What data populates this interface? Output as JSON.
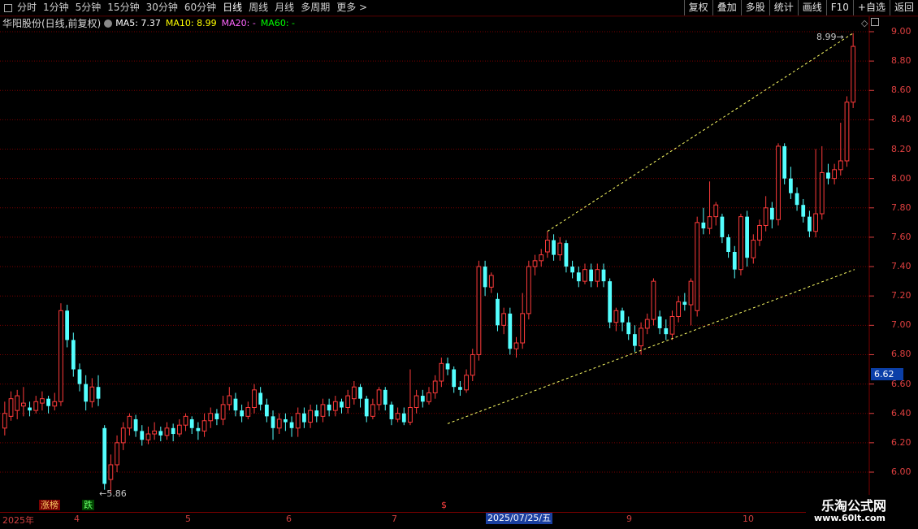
{
  "toolbar": {
    "left_items": [
      "分时",
      "1分钟",
      "5分钟",
      "15分钟",
      "30分钟",
      "60分钟",
      "日线",
      "周线",
      "月线",
      "多周期",
      "更多 >"
    ],
    "active": "日线",
    "right_items": [
      "复权",
      "叠加",
      "多股",
      "统计",
      "画线",
      "F10",
      "+自选",
      "返回"
    ]
  },
  "info": {
    "stock_name": "华阳股份(日线,前复权)",
    "ma5": "MA5: 7.37",
    "ma10": "MA10: 8.99",
    "ma20": "MA20: -",
    "ma60": "MA60: -"
  },
  "colors": {
    "up": "#ff3b3b",
    "down": "#54ffff",
    "axis": "#e04040",
    "grid": "#7a0000",
    "trend": "#ffff66",
    "ma5": "#ffffff",
    "ma10": "#ffff00",
    "ma20": "#ff66ff",
    "ma60": "#00ff00"
  },
  "y_axis": [
    "9.00",
    "8.80",
    "8.60",
    "8.40",
    "8.20",
    "8.00",
    "7.80",
    "7.60",
    "7.40",
    "7.20",
    "7.00",
    "6.80",
    "6.60",
    "6.40",
    "6.20",
    "6.00"
  ],
  "current_price": "6.62",
  "high_label": "8.99",
  "low_label": "5.86",
  "dates": {
    "d0": "2025年",
    "d4": "4",
    "d5": "5",
    "d6": "6",
    "d7": "7",
    "selected": "2025/07/25/五",
    "d9": "9",
    "d10": "10"
  },
  "badges": {
    "b1": "涨榜",
    "b2": "跌",
    "b3": "$"
  },
  "watermark": {
    "title": "乐淘公式网",
    "url": "www.60lt.com"
  },
  "chart_data": {
    "type": "candlestick",
    "ylim": [
      5.9,
      9.02
    ],
    "candles": [
      [
        6.3,
        6.4,
        6.25,
        6.48
      ],
      [
        6.38,
        6.5,
        6.35,
        6.55
      ],
      [
        6.42,
        6.52,
        6.36,
        6.56
      ],
      [
        6.45,
        6.47,
        6.38,
        6.58
      ],
      [
        6.44,
        6.42,
        6.38,
        6.48
      ],
      [
        6.42,
        6.48,
        6.4,
        6.52
      ],
      [
        6.47,
        6.5,
        6.42,
        6.55
      ],
      [
        6.5,
        6.45,
        6.4,
        6.52
      ],
      [
        6.45,
        6.48,
        6.42,
        6.54
      ],
      [
        6.48,
        7.1,
        6.45,
        7.15
      ],
      [
        7.1,
        6.9,
        6.85,
        7.14
      ],
      [
        6.9,
        6.7,
        6.65,
        6.95
      ],
      [
        6.7,
        6.6,
        6.55,
        6.74
      ],
      [
        6.6,
        6.48,
        6.42,
        6.66
      ],
      [
        6.48,
        6.58,
        6.44,
        6.64
      ],
      [
        6.58,
        6.5,
        6.45,
        6.66
      ],
      [
        6.3,
        5.92,
        5.88,
        6.32
      ],
      [
        5.95,
        6.05,
        5.86,
        6.12
      ],
      [
        6.05,
        6.2,
        6.0,
        6.25
      ],
      [
        6.2,
        6.3,
        6.15,
        6.34
      ],
      [
        6.3,
        6.38,
        6.25,
        6.4
      ],
      [
        6.36,
        6.28,
        6.24,
        6.39
      ],
      [
        6.28,
        6.22,
        6.18,
        6.32
      ],
      [
        6.22,
        6.26,
        6.19,
        6.31
      ],
      [
        6.26,
        6.28,
        6.22,
        6.34
      ],
      [
        6.28,
        6.25,
        6.21,
        6.31
      ],
      [
        6.25,
        6.3,
        6.22,
        6.34
      ],
      [
        6.3,
        6.26,
        6.21,
        6.33
      ],
      [
        6.26,
        6.32,
        6.24,
        6.36
      ],
      [
        6.32,
        6.38,
        6.28,
        6.4
      ],
      [
        6.36,
        6.3,
        6.26,
        6.38
      ],
      [
        6.3,
        6.28,
        6.22,
        6.34
      ],
      [
        6.28,
        6.35,
        6.24,
        6.4
      ],
      [
        6.35,
        6.4,
        6.3,
        6.44
      ],
      [
        6.4,
        6.36,
        6.32,
        6.43
      ],
      [
        6.36,
        6.46,
        6.32,
        6.52
      ],
      [
        6.46,
        6.52,
        6.42,
        6.58
      ],
      [
        6.5,
        6.42,
        6.38,
        6.54
      ],
      [
        6.42,
        6.38,
        6.34,
        6.46
      ],
      [
        6.38,
        6.44,
        6.36,
        6.48
      ],
      [
        6.44,
        6.56,
        6.4,
        6.6
      ],
      [
        6.54,
        6.46,
        6.42,
        6.58
      ],
      [
        6.46,
        6.38,
        6.34,
        6.5
      ],
      [
        6.38,
        6.3,
        6.22,
        6.42
      ],
      [
        6.3,
        6.36,
        6.26,
        6.4
      ],
      [
        6.36,
        6.34,
        6.28,
        6.4
      ],
      [
        6.34,
        6.3,
        6.24,
        6.38
      ],
      [
        6.3,
        6.4,
        6.24,
        6.44
      ],
      [
        6.4,
        6.34,
        6.3,
        6.44
      ],
      [
        6.34,
        6.42,
        6.3,
        6.46
      ],
      [
        6.42,
        6.38,
        6.34,
        6.46
      ],
      [
        6.38,
        6.46,
        6.34,
        6.5
      ],
      [
        6.46,
        6.42,
        6.38,
        6.5
      ],
      [
        6.42,
        6.48,
        6.38,
        6.52
      ],
      [
        6.48,
        6.44,
        6.4,
        6.5
      ],
      [
        6.44,
        6.52,
        6.4,
        6.56
      ],
      [
        6.5,
        6.58,
        6.46,
        6.62
      ],
      [
        6.58,
        6.5,
        6.44,
        6.6
      ],
      [
        6.5,
        6.38,
        6.34,
        6.52
      ],
      [
        6.38,
        6.46,
        6.36,
        6.5
      ],
      [
        6.46,
        6.56,
        6.42,
        6.58
      ],
      [
        6.56,
        6.46,
        6.42,
        6.58
      ],
      [
        6.46,
        6.36,
        6.32,
        6.48
      ],
      [
        6.36,
        6.4,
        6.34,
        6.44
      ],
      [
        6.4,
        6.34,
        6.32,
        6.44
      ],
      [
        6.34,
        6.44,
        6.32,
        6.7
      ],
      [
        6.44,
        6.52,
        6.4,
        6.56
      ],
      [
        6.52,
        6.48,
        6.44,
        6.56
      ],
      [
        6.48,
        6.54,
        6.46,
        6.58
      ],
      [
        6.54,
        6.62,
        6.5,
        6.66
      ],
      [
        6.62,
        6.74,
        6.58,
        6.78
      ],
      [
        6.74,
        6.7,
        6.66,
        6.78
      ],
      [
        6.7,
        6.58,
        6.54,
        6.72
      ],
      [
        6.58,
        6.56,
        6.52,
        6.62
      ],
      [
        6.56,
        6.66,
        6.54,
        6.7
      ],
      [
        6.66,
        6.8,
        6.62,
        6.84
      ],
      [
        6.8,
        7.4,
        6.76,
        7.44
      ],
      [
        7.4,
        7.26,
        7.2,
        7.44
      ],
      [
        7.26,
        7.34,
        7.22,
        7.36
      ],
      [
        7.18,
        7.0,
        6.96,
        7.22
      ],
      [
        7.0,
        7.08,
        6.94,
        7.12
      ],
      [
        7.08,
        6.84,
        6.8,
        7.12
      ],
      [
        6.84,
        6.88,
        6.78,
        6.92
      ],
      [
        6.88,
        7.08,
        6.84,
        7.22
      ],
      [
        7.08,
        7.4,
        7.04,
        7.44
      ],
      [
        7.4,
        7.44,
        7.34,
        7.48
      ],
      [
        7.44,
        7.48,
        7.4,
        7.52
      ],
      [
        7.5,
        7.58,
        7.46,
        7.64
      ],
      [
        7.58,
        7.48,
        7.44,
        7.62
      ],
      [
        7.48,
        7.56,
        7.44,
        7.6
      ],
      [
        7.56,
        7.4,
        7.36,
        7.58
      ],
      [
        7.4,
        7.36,
        7.32,
        7.44
      ],
      [
        7.36,
        7.3,
        7.26,
        7.4
      ],
      [
        7.3,
        7.38,
        7.28,
        7.42
      ],
      [
        7.38,
        7.3,
        7.26,
        7.42
      ],
      [
        7.3,
        7.38,
        7.26,
        7.42
      ],
      [
        7.38,
        7.3,
        7.26,
        7.42
      ],
      [
        7.3,
        7.02,
        6.98,
        7.32
      ],
      [
        7.02,
        7.1,
        6.96,
        7.12
      ],
      [
        7.1,
        7.02,
        6.96,
        7.12
      ],
      [
        7.02,
        6.94,
        6.9,
        7.06
      ],
      [
        6.94,
        6.86,
        6.82,
        7.0
      ],
      [
        6.86,
        6.98,
        6.8,
        7.02
      ],
      [
        6.98,
        7.04,
        6.94,
        7.08
      ],
      [
        7.04,
        7.3,
        7.0,
        7.32
      ],
      [
        7.06,
        6.98,
        6.94,
        7.1
      ],
      [
        6.98,
        6.94,
        6.9,
        7.04
      ],
      [
        6.94,
        7.06,
        6.9,
        7.1
      ],
      [
        7.06,
        7.16,
        7.02,
        7.2
      ],
      [
        7.16,
        7.14,
        7.1,
        7.22
      ],
      [
        7.14,
        7.3,
        7.0,
        7.32
      ],
      [
        7.1,
        7.7,
        7.06,
        7.74
      ],
      [
        7.7,
        7.66,
        7.62,
        7.8
      ],
      [
        7.66,
        7.74,
        7.62,
        7.98
      ],
      [
        7.74,
        7.82,
        7.68,
        7.84
      ],
      [
        7.74,
        7.6,
        7.56,
        7.76
      ],
      [
        7.6,
        7.5,
        7.46,
        7.62
      ],
      [
        7.5,
        7.38,
        7.32,
        7.54
      ],
      [
        7.38,
        7.74,
        7.34,
        7.76
      ],
      [
        7.74,
        7.46,
        7.4,
        7.78
      ],
      [
        7.46,
        7.58,
        7.42,
        7.62
      ],
      [
        7.58,
        7.68,
        7.54,
        7.72
      ],
      [
        7.68,
        7.8,
        7.64,
        7.88
      ],
      [
        7.8,
        7.72,
        7.66,
        7.84
      ],
      [
        7.72,
        8.22,
        7.68,
        8.24
      ],
      [
        8.22,
        8.0,
        7.96,
        8.24
      ],
      [
        8.0,
        7.9,
        7.86,
        8.08
      ],
      [
        7.9,
        7.82,
        7.78,
        7.94
      ],
      [
        7.82,
        7.74,
        7.7,
        7.86
      ],
      [
        7.74,
        7.64,
        7.6,
        7.78
      ],
      [
        7.64,
        7.76,
        7.6,
        8.2
      ],
      [
        7.76,
        8.04,
        7.72,
        8.22
      ],
      [
        8.04,
        8.0,
        7.96,
        8.1
      ],
      [
        8.0,
        8.06,
        7.96,
        8.1
      ],
      [
        8.06,
        8.12,
        8.02,
        8.38
      ],
      [
        8.12,
        8.52,
        8.08,
        8.56
      ],
      [
        8.52,
        8.9,
        8.48,
        8.99
      ]
    ]
  }
}
